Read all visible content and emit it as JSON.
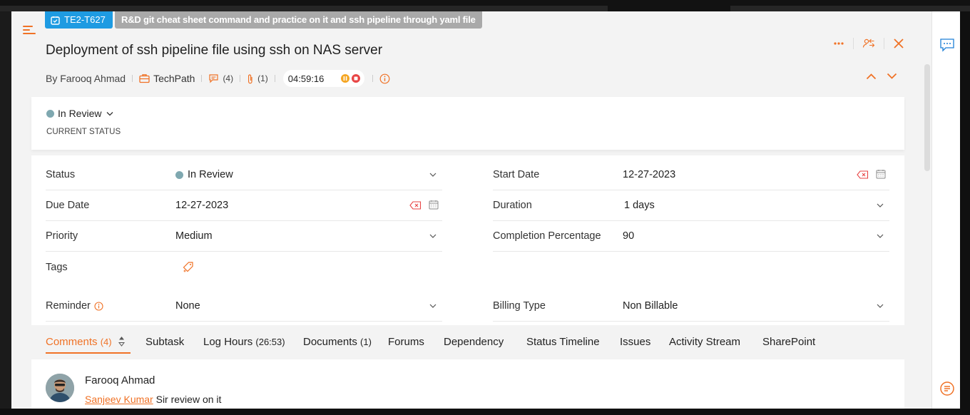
{
  "task": {
    "id": "TE2-T627",
    "parent": "R&D git cheat sheet command and practice on it and ssh pipeline through yaml file",
    "title": "Deployment of ssh pipeline file using ssh on NAS server",
    "author": "By Farooq Ahmad",
    "project": "TechPath",
    "comment_count": "(4)",
    "attachment_count": "(1)",
    "timer": "04:59:16"
  },
  "status_card": {
    "status": "In Review",
    "caption": "CURRENT STATUS",
    "status_color": "#7fa8b0"
  },
  "fields": {
    "status_label": "Status",
    "status_value": "In Review",
    "start_date_label": "Start Date",
    "start_date_value": "12-27-2023",
    "due_date_label": "Due Date",
    "due_date_value": "12-27-2023",
    "duration_label": "Duration",
    "duration_value": "1 days",
    "priority_label": "Priority",
    "priority_value": "Medium",
    "completion_label": "Completion Percentage",
    "completion_value": "90",
    "tags_label": "Tags",
    "reminder_label": "Reminder",
    "reminder_value": "None",
    "billing_label": "Billing Type",
    "billing_value": "Non Billable"
  },
  "tabs": [
    {
      "label": "Comments",
      "count": "(4)"
    },
    {
      "label": "Subtask",
      "count": ""
    },
    {
      "label": "Log Hours",
      "count": "(26:53)"
    },
    {
      "label": "Documents",
      "count": "(1)"
    },
    {
      "label": "Forums",
      "count": ""
    },
    {
      "label": "Dependency",
      "count": ""
    },
    {
      "label": "Status Timeline",
      "count": ""
    },
    {
      "label": "Issues",
      "count": ""
    },
    {
      "label": "Activity Stream",
      "count": ""
    },
    {
      "label": "SharePoint",
      "count": ""
    }
  ],
  "comment": {
    "author": "Farooq Ahmad",
    "mention": "Sanjeev Kumar",
    "text": " Sir review on it"
  },
  "colors": {
    "accent": "#f07226",
    "id_chip": "#1e9be2",
    "parent_chip": "#a9a9a9",
    "danger": "#e84545"
  },
  "icons": [
    "menu-icon",
    "task-icon",
    "project-icon",
    "comment-icon",
    "attachment-icon",
    "pause-icon",
    "stop-icon",
    "info-icon",
    "more-icon",
    "transfer-icon",
    "close-icon",
    "chevron-up-icon",
    "chevron-down-icon",
    "clear-icon",
    "calendar-icon",
    "tag-add-icon",
    "sort-icon",
    "feedback-icon",
    "chat-icon"
  ]
}
